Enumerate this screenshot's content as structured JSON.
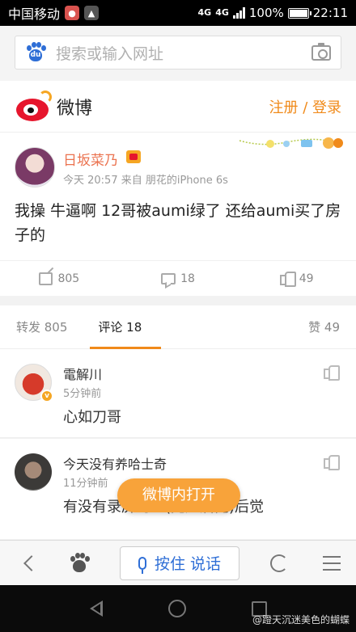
{
  "status_bar": {
    "carrier": "中国移动",
    "network": "4G",
    "signal_label": "4G",
    "battery": "100%",
    "time": "22:11"
  },
  "search": {
    "placeholder": "搜索或输入网址",
    "logo_label": "du"
  },
  "header": {
    "app_name": "微博",
    "register_login": "注册 / 登录"
  },
  "post": {
    "author": "日坂菜乃",
    "meta": "今天 20:57 来自 朋花的iPhone 6s",
    "text": "我操 牛逼啊 12哥被aumi绿了 还给aumi买了房子的",
    "reposts": "805",
    "comments": "18",
    "likes": "49"
  },
  "tabs": {
    "repost": "转发 805",
    "comment": "评论 18",
    "like": "赞 49"
  },
  "comments": [
    {
      "name": "電解川",
      "time": "5分钟前",
      "text": "心如刀哥",
      "verified_mark": "v"
    },
    {
      "name": "今天没有养哈士奇",
      "time": "11分钟前",
      "text": "有没有录屏的…(先知后觉)后觉"
    }
  ],
  "open_button": "微博内打开",
  "toolbar": {
    "voice_label": "按住 说话"
  },
  "watermark": "@蹬天沉迷美色的蝴蝶",
  "colors": {
    "accent_orange": "#f08a1a",
    "weibo_red": "#e6162d",
    "baidu_blue": "#2e6ed6",
    "open_button": "#f8a33a"
  }
}
